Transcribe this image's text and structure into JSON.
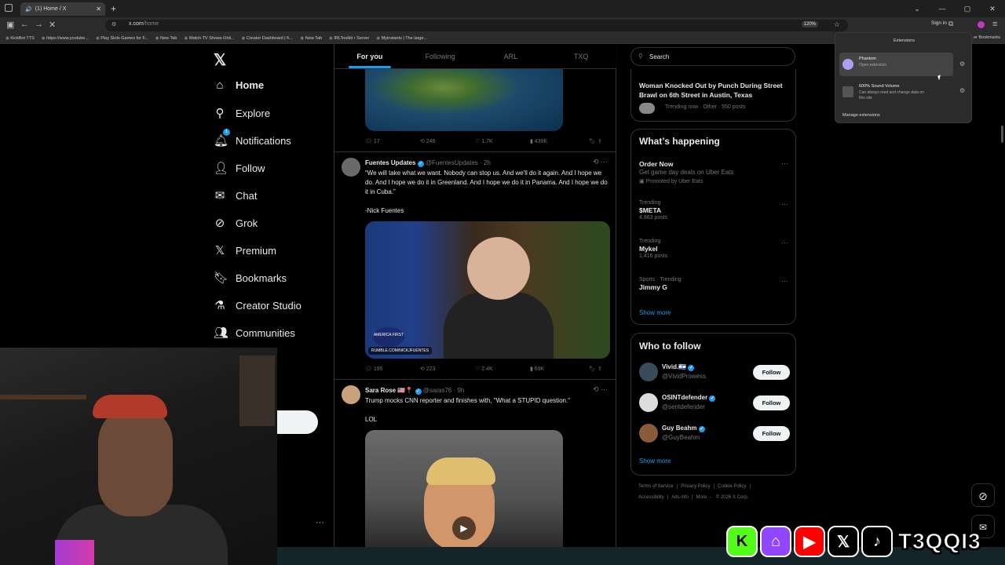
{
  "browser": {
    "tab_title": "(1) Home / X",
    "url_host": "x.com",
    "url_path": "/home",
    "zoom": "120%",
    "sign_in": "Sign in",
    "bookmarks": [
      "KickBot TTS",
      "https://www.youtube...",
      "Play Slots Games for F...",
      "New Tab",
      "Watch TV Shows Onli...",
      "Creator Dashboard | K...",
      "New Tab",
      "IRLToolkit • Server",
      "Myinstants | The large..."
    ],
    "all_bookmarks": "er Bookmarks"
  },
  "extensions": {
    "header": "Extensions",
    "items": [
      {
        "name": "Phantom",
        "desc": "Open extension"
      },
      {
        "name": "600% Sound Volume",
        "desc": "Can always read and change data on this site"
      }
    ],
    "manage": "Manage extensions"
  },
  "sidebar": {
    "notification_count": "1",
    "items": [
      {
        "label": "Home"
      },
      {
        "label": "Explore"
      },
      {
        "label": "Notifications"
      },
      {
        "label": "Follow"
      },
      {
        "label": "Chat"
      },
      {
        "label": "Grok"
      },
      {
        "label": "Premium"
      },
      {
        "label": "Bookmarks"
      },
      {
        "label": "Creator Studio"
      },
      {
        "label": "Communities"
      }
    ]
  },
  "feed": {
    "tabs": [
      "For you",
      "Following",
      "ARL",
      "TXQ"
    ],
    "tweet0_stats": {
      "replies": "17",
      "reposts": "246",
      "likes": "1.7K",
      "views": "439K"
    },
    "tweet1": {
      "name": "Fuentes Updates",
      "handle": "@FuentesUpdates · 2h",
      "text": "“We will take what we want. Nobody can stop us. And we'll do it again. And I hope we do. And I hope we do it in Greenland. And I hope we do it in Panama. And I hope we do it in Cuba.”",
      "text2": "-Nick Fuentes",
      "media_caption": "RUMBLE.COM/NICKJFUENTES",
      "media_badge": "AMERICA FIRST",
      "stats": {
        "replies": "195",
        "reposts": "223",
        "likes": "2.4K",
        "views": "69K"
      }
    },
    "tweet2": {
      "name": "Sara Rose",
      "flags": "🇺🇸📍",
      "handle": "@saras76 · 9h",
      "text": "Trump mocks CNN reporter and finishes with, \"What a STUPID question.\"",
      "text2": "LOL"
    }
  },
  "right": {
    "search_placeholder": "Search",
    "top_trend": {
      "title": "Woman Knocked Out by Punch During Street Brawl on 6th Street in Austin, Texas",
      "meta": "Trending now · Other · 550 posts"
    },
    "happening_title": "What’s happening",
    "ad": {
      "name": "Order Now",
      "sub": "Get game day deals on Uber Eats",
      "promo": "Promoted by Uber Eats"
    },
    "trends": [
      {
        "meta": "Trending",
        "name": "$META",
        "sub": "4,863 posts"
      },
      {
        "meta": "Trending",
        "name": "Mykel",
        "sub": "1,416 posts"
      },
      {
        "meta": "Sports · Trending",
        "name": "Jimmy G",
        "sub": ""
      }
    ],
    "show_more": "Show more",
    "wtf_title": "Who to follow",
    "follow_label": "Follow",
    "wtf": [
      {
        "name": "Vivid.🇮🇱",
        "handle": "@VividProwess"
      },
      {
        "name": "OSINTdefender",
        "handle": "@sentdefender"
      },
      {
        "name": "Guy Beahm",
        "handle": "@GuyBeahm"
      }
    ],
    "footer1": [
      "Terms of Service",
      "|",
      "Privacy Policy",
      "|",
      "Cookie Policy",
      "|"
    ],
    "footer2": [
      "Accessibility",
      "|",
      "Ads info",
      "|",
      "More ···",
      "© 2026 X Corp."
    ]
  },
  "overlay": {
    "social_handle": "T3QQI3",
    "icons": [
      "kick-icon",
      "twitch-icon",
      "youtube-icon",
      "x-icon",
      "tiktok-icon"
    ]
  }
}
